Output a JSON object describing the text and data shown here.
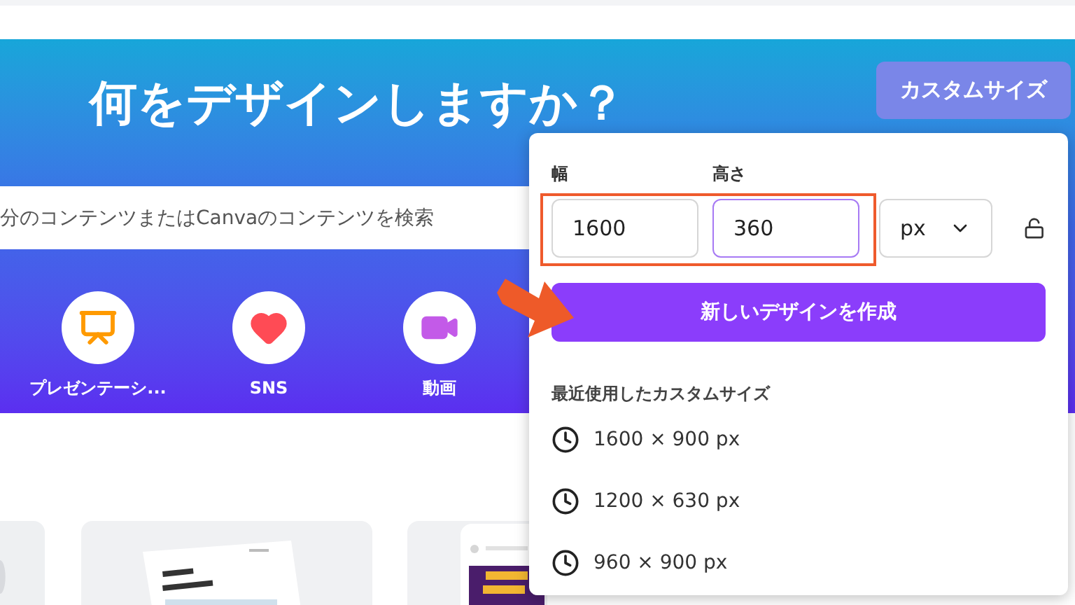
{
  "banner": {
    "title": "何をデザインしますか？",
    "custom_size_button": "カスタムサイズ"
  },
  "search": {
    "placeholder": "分のコンテンツまたはCanvaのコンテンツを検索"
  },
  "categories": [
    {
      "label": "プレゼンテーシ...",
      "kind": "presentation"
    },
    {
      "label": "SNS",
      "kind": "social"
    },
    {
      "label": "動画",
      "kind": "video"
    }
  ],
  "popup": {
    "width_label": "幅",
    "height_label": "高さ",
    "fields": [
      {
        "value": "1600",
        "focused": false
      },
      {
        "value": "360",
        "focused": true
      }
    ],
    "unit": "px",
    "create_button": "新しいデザインを作成",
    "recent_heading": "最近使用したカスタムサイズ",
    "recent": [
      "1600 × 900 px",
      "1200 × 630 px",
      "960 × 900 px"
    ]
  }
}
